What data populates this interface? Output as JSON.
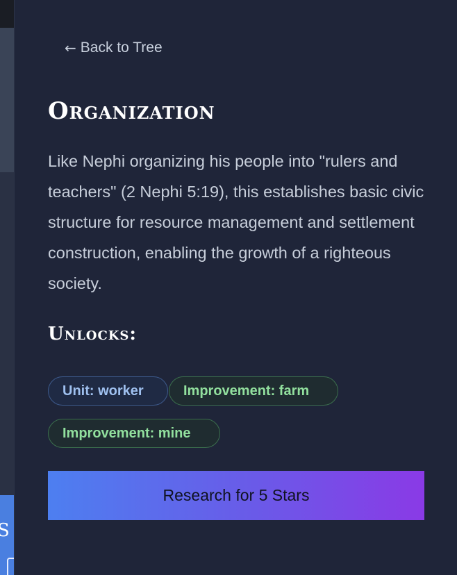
{
  "background_peek": {
    "letter": "S"
  },
  "nav": {
    "back_arrow": "←",
    "back_label": "Back to Tree"
  },
  "tech": {
    "title": "Organization",
    "description": "Like Nephi organizing his people into \"rulers and teachers\" (2 Nephi 5:19), this establishes basic civic structure for resource management and settlement construction, enabling the growth of a righteous society."
  },
  "unlocks": {
    "heading": "Unlocks:",
    "tags": [
      {
        "label": "Unit: worker",
        "kind": "unit",
        "color": "#9fc0ef"
      },
      {
        "label": "Improvement: farm",
        "kind": "improvement",
        "color": "#92e09e"
      },
      {
        "label": "Improvement: mine",
        "kind": "improvement",
        "color": "#92e09e"
      }
    ]
  },
  "action": {
    "research_label": "Research for 5 Stars"
  },
  "colors": {
    "panel_bg": "#1f2539",
    "gradient_start": "#4d7ff0",
    "gradient_end": "#8a3ae6"
  }
}
